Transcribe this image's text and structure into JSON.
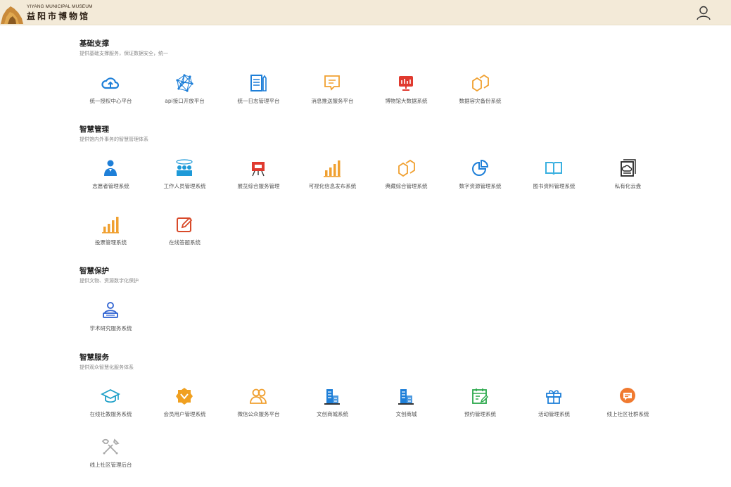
{
  "header": {
    "logo_en": "YIYANG MUNICIPAL MUSEUM",
    "logo_cn": "益阳市博物馆"
  },
  "sections": [
    {
      "title": "基础支撑",
      "desc": "提供基础支撑服务，保证数据安全，统一",
      "items": [
        {
          "label": "统一授权中心平台",
          "icon": "cloud-upload-icon",
          "color": "#1e7fd8"
        },
        {
          "label": "api接口开放平台",
          "icon": "network-icon",
          "color": "#1e7fd8"
        },
        {
          "label": "统一日志管理平台",
          "icon": "log-document-icon",
          "color": "#1e7fd8"
        },
        {
          "label": "消息推送服务平台",
          "icon": "message-icon",
          "color": "#f0a030"
        },
        {
          "label": "博物馆大数据系统",
          "icon": "big-data-screen-icon",
          "color": "#e03a2f"
        },
        {
          "label": "数据容灾备份系统",
          "icon": "backup-icon",
          "color": "#f0a030"
        }
      ]
    },
    {
      "title": "智慧管理",
      "desc": "提供馆内外事务的智慧管理体系",
      "items": [
        {
          "label": "志愿者管理系统",
          "icon": "volunteer-icon",
          "color": "#1e7fd8"
        },
        {
          "label": "工作人员管理系统",
          "icon": "staff-icon",
          "color": "#1e9ad8"
        },
        {
          "label": "展览综合服务管理",
          "icon": "exhibition-easel-icon",
          "color": "#e03a2f"
        },
        {
          "label": "可视化信息发布系统",
          "icon": "bar-chart-icon",
          "color": "#f0a030"
        },
        {
          "label": "典藏综合管理系统",
          "icon": "collection-icon",
          "color": "#f0a030"
        },
        {
          "label": "数字资源管理系统",
          "icon": "pie-chart-icon",
          "color": "#1e7fd8"
        },
        {
          "label": "图书资料管理系统",
          "icon": "book-icon",
          "color": "#3ab0e0"
        },
        {
          "label": "私有化云盘",
          "icon": "cloud-drive-icon",
          "color": "#222222"
        },
        {
          "label": "投票管理系统",
          "icon": "vote-bar-icon",
          "color": "#f0a030"
        },
        {
          "label": "在线答题系统",
          "icon": "edit-icon",
          "color": "#d84a2a"
        }
      ]
    },
    {
      "title": "智慧保护",
      "desc": "提供文物、资源数字化保护",
      "items": [
        {
          "label": "学术研究服务系统",
          "icon": "researcher-icon",
          "color": "#2a5fd0"
        }
      ]
    },
    {
      "title": "智慧服务",
      "desc": "提供观众智慧化服务体系",
      "items": [
        {
          "label": "在线社教服务系统",
          "icon": "graduation-cap-icon",
          "color": "#1ea0c8"
        },
        {
          "label": "会员用户管理系统",
          "icon": "member-badge-icon",
          "color": "#f0a020"
        },
        {
          "label": "微信公众服务平台",
          "icon": "users-icon",
          "color": "#f0a030"
        },
        {
          "label": "文创商城系统",
          "icon": "building-icon",
          "color": "#1e7fd8"
        },
        {
          "label": "文创商城",
          "icon": "building-icon",
          "color": "#1e7fd8"
        },
        {
          "label": "预约管理系统",
          "icon": "calendar-icon",
          "color": "#2aa84a"
        },
        {
          "label": "活动管理系统",
          "icon": "gift-icon",
          "color": "#1e7fd8"
        },
        {
          "label": "线上社区社群系统",
          "icon": "chat-bubble-icon",
          "color": "#f07a30"
        },
        {
          "label": "线上社区管理后台",
          "icon": "tools-icon",
          "color": "#aaaaaa"
        }
      ]
    }
  ]
}
